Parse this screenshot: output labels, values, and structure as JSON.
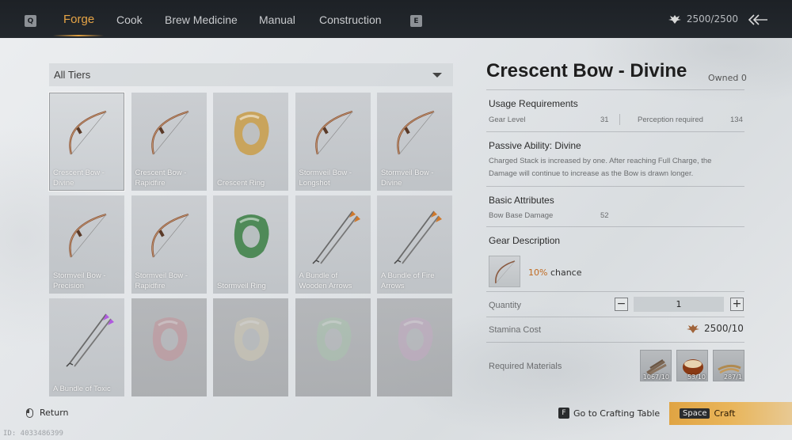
{
  "tabs": {
    "prev_key": "Q",
    "next_key": "E",
    "items": [
      {
        "label": "Forge",
        "active": true
      },
      {
        "label": "Cook",
        "active": false
      },
      {
        "label": "Brew Medicine",
        "active": false
      },
      {
        "label": "Manual",
        "active": false
      },
      {
        "label": "Construction",
        "active": false
      }
    ]
  },
  "stamina_top": "2500/2500",
  "filter": {
    "selected": "All Tiers"
  },
  "items": [
    {
      "name": "Crescent Bow - Divine",
      "icon": "bow-icon",
      "selected": true
    },
    {
      "name": "Crescent Bow - Rapidfire",
      "icon": "bow-icon"
    },
    {
      "name": "Crescent Ring",
      "icon": "ring-icon",
      "color": "#c9a45c"
    },
    {
      "name": "Stormveil Bow - Longshot",
      "icon": "bow-icon"
    },
    {
      "name": "Stormveil Bow - Divine",
      "icon": "bow-icon"
    },
    {
      "name": "Stormveil Bow - Precision",
      "icon": "bow-icon"
    },
    {
      "name": "Stormveil Bow - Rapidfire",
      "icon": "bow-icon"
    },
    {
      "name": "Stormveil Ring",
      "icon": "ring-icon",
      "color": "#4f8a58"
    },
    {
      "name": "A Bundle of Wooden Arrows",
      "icon": "arrows-icon"
    },
    {
      "name": "A Bundle of Fire Arrows",
      "icon": "arrows-icon"
    },
    {
      "name": "A Bundle of Toxic",
      "icon": "arrows-icon",
      "color": "#b05adf"
    },
    {
      "name": "",
      "icon": "ring-icon",
      "color": "#c98a92",
      "locked": true
    },
    {
      "name": "",
      "icon": "ring-icon",
      "color": "#d8cfb4",
      "locked": true
    },
    {
      "name": "",
      "icon": "ring-icon",
      "color": "#a8c9ad",
      "locked": true
    },
    {
      "name": "",
      "icon": "ring-icon",
      "color": "#c8a8c6",
      "locked": true
    }
  ],
  "detail": {
    "title": "Crescent Bow - Divine",
    "owned": "Owned 0",
    "usage_header": "Usage Requirements",
    "gear_level_label": "Gear Level",
    "gear_level_value": "31",
    "perception_label": "Perception required",
    "perception_value": "134",
    "passive_header": "Passive Ability: Divine",
    "passive_line1": "Charged Stack is increased by one. After reaching Full Charge, the",
    "passive_line2": "Damage will continue to increase as the Bow is drawn longer.",
    "basic_header": "Basic Attributes",
    "base_damage_label": "Bow Base Damage",
    "base_damage_value": "52",
    "gear_desc_header": "Gear Description",
    "chance_pct": "10%",
    "chance_text": "chance",
    "quantity_label": "Quantity",
    "quantity_value": "1",
    "stamina_label": "Stamina Cost",
    "stamina_value": "2500/10",
    "materials_label": "Required Materials",
    "materials": [
      {
        "icon": "wood-icon",
        "count": "1067/10"
      },
      {
        "icon": "chestnut-icon",
        "count": "53/10"
      },
      {
        "icon": "fiber-icon",
        "count": "287/1"
      }
    ]
  },
  "footer": {
    "return_label": "Return",
    "goto_key": "F",
    "goto_label": "Go to Crafting Table",
    "craft_key": "Space",
    "craft_label": "Craft",
    "uid": "ID: 4033486399"
  }
}
